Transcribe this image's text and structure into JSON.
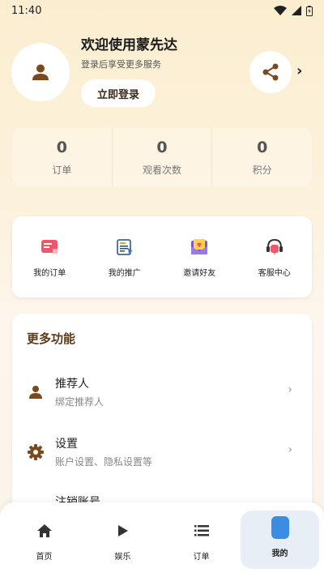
{
  "status_bar": {
    "time": "11:40"
  },
  "profile": {
    "welcome": "欢迎使用蒙先达",
    "subtitle": "登录后享受更多服务",
    "login_button": "立即登录"
  },
  "stats": [
    {
      "value": "0",
      "label": "订单"
    },
    {
      "value": "0",
      "label": "观看次数"
    },
    {
      "value": "0",
      "label": "积分"
    }
  ],
  "quick_actions": [
    {
      "label": "我的订单",
      "icon": "order-icon"
    },
    {
      "label": "我的推广",
      "icon": "promotion-icon"
    },
    {
      "label": "邀请好友",
      "icon": "invite-icon"
    },
    {
      "label": "客服中心",
      "icon": "support-icon"
    }
  ],
  "more": {
    "title": "更多功能",
    "items": [
      {
        "title": "推荐人",
        "subtitle": "绑定推荐人",
        "icon": "person-icon"
      },
      {
        "title": "设置",
        "subtitle": "账户设置、隐私设置等",
        "icon": "gear-icon"
      },
      {
        "title": "注销账号",
        "subtitle": "",
        "icon": "delete-icon"
      }
    ]
  },
  "bottom_nav": [
    {
      "label": "首页",
      "icon": "home-icon",
      "active": false
    },
    {
      "label": "娱乐",
      "icon": "play-icon",
      "active": false
    },
    {
      "label": "订单",
      "icon": "list-icon",
      "active": false
    },
    {
      "label": "我的",
      "icon": "profile-icon",
      "active": true
    }
  ],
  "colors": {
    "accent_brown": "#7a4a1e",
    "active_nav_bg": "#e7eef6",
    "active_nav_icon": "#3b8de3"
  }
}
